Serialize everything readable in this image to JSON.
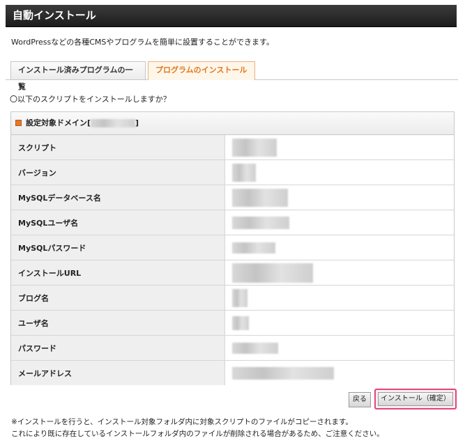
{
  "header": {
    "title": "自動インストール"
  },
  "description": "WordPressなどの各種CMSやプログラムを簡単に設置することができます。",
  "tabs": [
    {
      "label": "インストール済みプログラムの一覧",
      "active": false
    },
    {
      "label": "プログラムのインストール",
      "active": true
    }
  ],
  "question": "〇以下のスクリプトをインストールしますか？",
  "panel": {
    "domain_label_prefix": "設定対象ドメイン[",
    "domain_label_suffix": "]"
  },
  "rows": [
    {
      "label": "スクリプト"
    },
    {
      "label": "バージョン"
    },
    {
      "label": "MySQLデータベース名"
    },
    {
      "label": "MySQLユーザ名"
    },
    {
      "label": "MySQLパスワード"
    },
    {
      "label": "インストールURL"
    },
    {
      "label": "ブログ名"
    },
    {
      "label": "ユーザ名"
    },
    {
      "label": "パスワード"
    },
    {
      "label": "メールアドレス"
    }
  ],
  "buttons": {
    "back": "戻る",
    "confirm": "インストール（確定）"
  },
  "notes": [
    "※インストールを行うと、インストール対象フォルダ内に対象スクリプトのファイルがコピーされます。",
    "これにより既に存在しているインストールフォルダ内のファイルが削除される場合があるため、ご注意ください。"
  ],
  "colors": {
    "header_bg": "#2a2a2a",
    "active_tab_text": "#e0771e",
    "confirm_highlight": "#e0457b"
  }
}
